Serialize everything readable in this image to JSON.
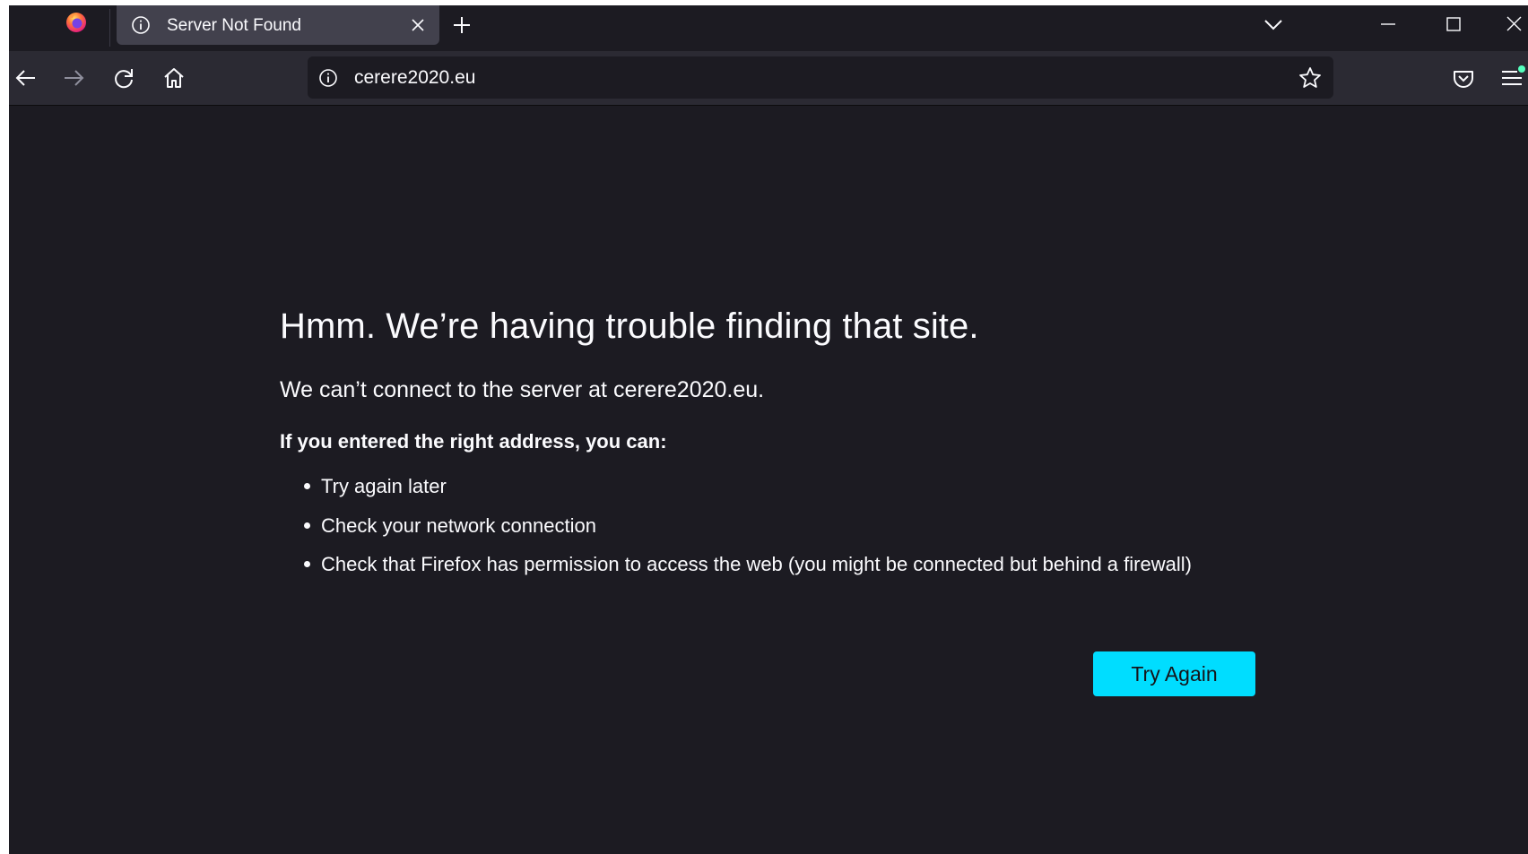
{
  "tab": {
    "title": "Server Not Found"
  },
  "urlbar": {
    "url": "cerere2020.eu"
  },
  "error": {
    "title": "Hmm. We’re having trouble finding that site.",
    "description": "We can’t connect to the server at cerere2020.eu.",
    "subtitle": "If you entered the right address, you can:",
    "suggestions": [
      "Try again later",
      "Check your network connection",
      "Check that Firefox has permission to access the web (you might be connected but behind a firewall)"
    ],
    "button_label": "Try Again"
  },
  "icons": {
    "browser_logo": "firefox-logo-icon",
    "tab": "info-icon",
    "tab_close": "close-icon",
    "new_tab": "plus-icon",
    "tab_list": "chevron-down-icon",
    "back": "arrow-left-icon",
    "forward": "arrow-right-icon",
    "reload": "reload-icon",
    "home": "home-icon",
    "url_info": "info-icon",
    "bookmark": "star-icon",
    "pocket": "pocket-icon",
    "menu": "hamburger-menu-icon"
  },
  "colors": {
    "background": "#1c1b22",
    "toolbar": "#2b2a33",
    "active_tab": "#42414d",
    "text": "#fbfbfe",
    "accent_button": "#00ddff",
    "disabled_icon": "#8f8f9d",
    "notification_dot": "#54ffbd"
  }
}
